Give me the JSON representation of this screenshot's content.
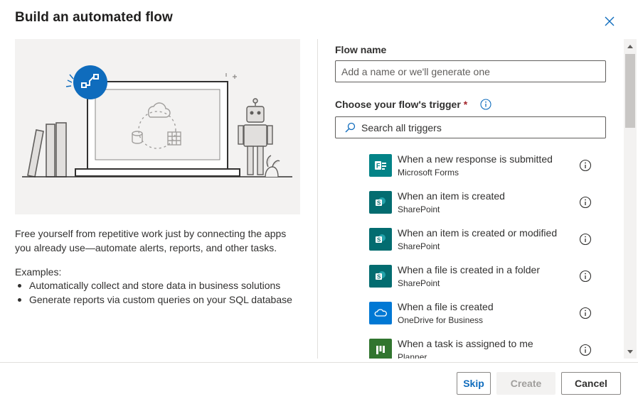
{
  "dialog": {
    "title": "Build an automated flow",
    "close_icon": "close-icon"
  },
  "left": {
    "description": "Free yourself from repetitive work just by connecting the apps you already use—automate alerts, reports, and other tasks.",
    "examples_label": "Examples:",
    "examples": [
      "Automatically collect and store data in business solutions",
      "Generate reports via custom queries on your SQL database"
    ]
  },
  "form": {
    "flow_name_label": "Flow name",
    "flow_name_placeholder": "Add a name or we'll generate one",
    "flow_name_value": "",
    "trigger_label": "Choose your flow's trigger",
    "required_mark": "*",
    "search_placeholder": "Search all triggers",
    "search_value": ""
  },
  "triggers": [
    {
      "title": "When a new response is submitted",
      "connector": "Microsoft Forms",
      "icon": "forms-icon",
      "color": "#038387"
    },
    {
      "title": "When an item is created",
      "connector": "SharePoint",
      "icon": "sharepoint-icon",
      "color": "#036c70"
    },
    {
      "title": "When an item is created or modified",
      "connector": "SharePoint",
      "icon": "sharepoint-icon",
      "color": "#036c70"
    },
    {
      "title": "When a file is created in a folder",
      "connector": "SharePoint",
      "icon": "sharepoint-icon",
      "color": "#036c70"
    },
    {
      "title": "When a file is created",
      "connector": "OneDrive for Business",
      "icon": "onedrive-icon",
      "color": "#0078d4"
    },
    {
      "title": "When a task is assigned to me",
      "connector": "Planner",
      "icon": "planner-icon",
      "color": "#31752f"
    }
  ],
  "footer": {
    "skip_label": "Skip",
    "create_label": "Create",
    "cancel_label": "Cancel"
  },
  "colors": {
    "accent": "#0f6cbd",
    "flow_badge": "#0f6cbd",
    "required": "#a4262c"
  }
}
